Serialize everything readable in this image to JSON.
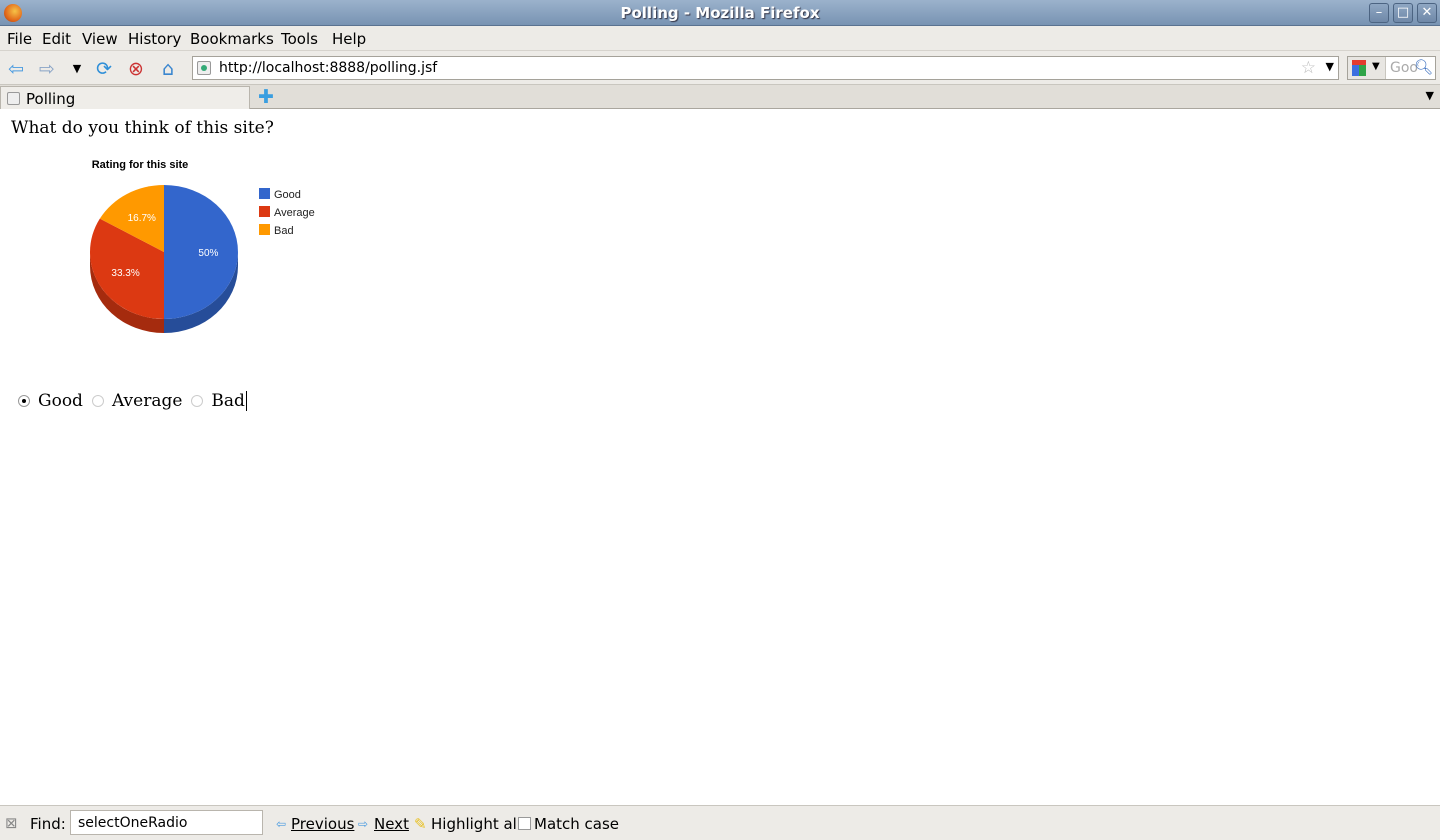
{
  "window": {
    "title": "Polling - Mozilla Firefox"
  },
  "menu": [
    "File",
    "Edit",
    "View",
    "History",
    "Bookmarks",
    "Tools",
    "Help"
  ],
  "navbar": {
    "url": "http://localhost:8888/polling.jsf",
    "search_placeholder": "Goo"
  },
  "tabs": [
    {
      "label": "Polling"
    }
  ],
  "page": {
    "question": "What do you think of this site?",
    "options": [
      {
        "label": "Good",
        "selected": true
      },
      {
        "label": "Average",
        "selected": false
      },
      {
        "label": "Bad",
        "selected": false
      }
    ]
  },
  "chart_data": {
    "type": "pie",
    "title": "Rating for this site",
    "categories": [
      "Good",
      "Average",
      "Bad"
    ],
    "values": [
      50,
      33.3,
      16.7
    ],
    "labels": [
      "50%",
      "33.3%",
      "16.7%"
    ],
    "colors": [
      "#3366cc",
      "#dc3912",
      "#ff9900"
    ],
    "legend": "right",
    "style": "3d"
  },
  "findbar": {
    "label": "Find:",
    "query": "selectOneRadio",
    "previous": "Previous",
    "next": "Next",
    "highlight_all": "Highlight all",
    "match_case": "Match case",
    "match_case_checked": false
  }
}
